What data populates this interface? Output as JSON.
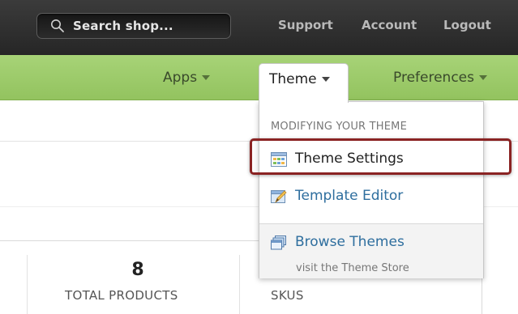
{
  "topbar": {
    "search_placeholder": "Search shop...",
    "links": [
      "Support",
      "Account",
      "Logout"
    ]
  },
  "nav": {
    "apps": "Apps",
    "theme": "Theme",
    "preferences": "Preferences"
  },
  "dropdown": {
    "heading": "MODIFYING YOUR THEME",
    "items": [
      {
        "label": "Theme Settings",
        "icon": "grid-icon"
      },
      {
        "label": "Template Editor",
        "icon": "edit-icon"
      },
      {
        "label": "Browse Themes",
        "icon": "themes-icon",
        "sublabel": "visit the Theme Store"
      }
    ]
  },
  "stats": {
    "total_products_value": "8",
    "total_products_label": "TOTAL PRODUCTS",
    "skus_label": "SKUS"
  },
  "colors": {
    "topbar": "#2e2e2e",
    "navbar": "#9fcd6d",
    "highlight": "#8a2323",
    "link": "#2e6e9e"
  }
}
